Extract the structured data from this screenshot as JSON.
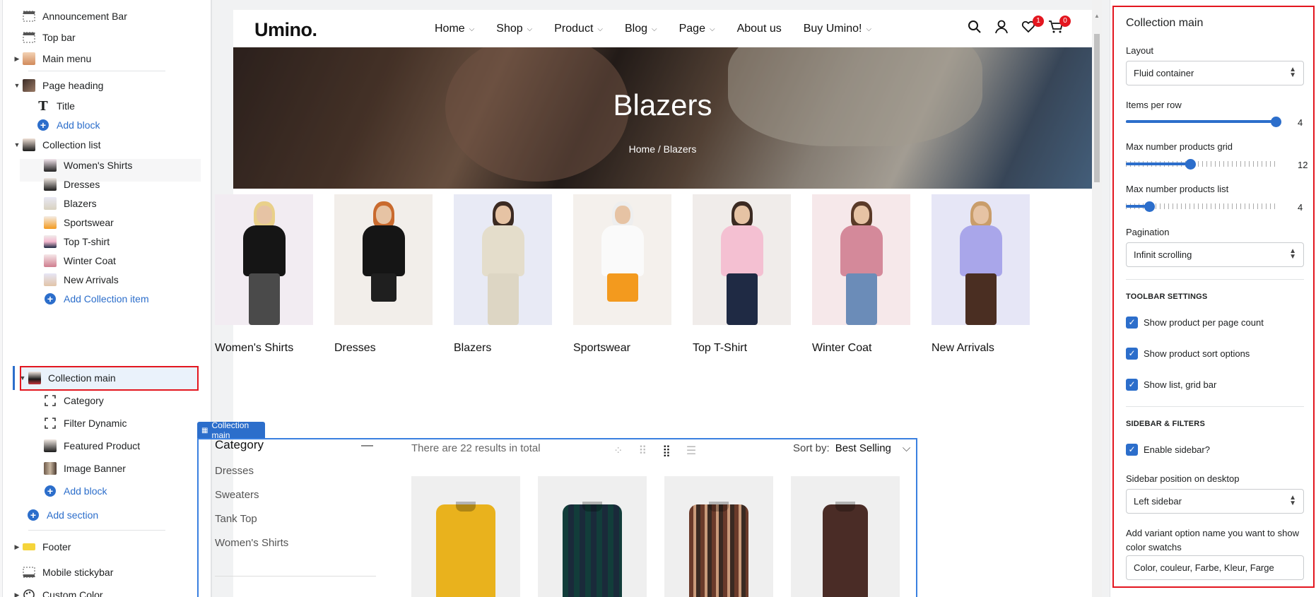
{
  "sidebar": {
    "items": [
      {
        "label": "Announcement Bar"
      },
      {
        "label": "Top bar"
      },
      {
        "label": "Main menu"
      },
      {
        "label": "Page heading"
      },
      {
        "label": "Title"
      },
      {
        "label": "Add block"
      },
      {
        "label": "Collection list"
      },
      {
        "label": "Women's Shirts"
      },
      {
        "label": "Dresses"
      },
      {
        "label": "Blazers"
      },
      {
        "label": "Sportswear"
      },
      {
        "label": "Top T-shirt"
      },
      {
        "label": "Winter Coat"
      },
      {
        "label": "New Arrivals"
      },
      {
        "label": "Add Collection item"
      },
      {
        "label": "Collection main"
      },
      {
        "label": "Category"
      },
      {
        "label": "Filter Dynamic"
      },
      {
        "label": "Featured Product"
      },
      {
        "label": "Image Banner"
      },
      {
        "label": "Add block"
      },
      {
        "label": "Add section"
      },
      {
        "label": "Footer"
      },
      {
        "label": "Mobile stickybar"
      },
      {
        "label": "Custom Color"
      }
    ]
  },
  "store": {
    "logo": "Umino.",
    "nav": [
      "Home",
      "Shop",
      "Product",
      "Blog",
      "Page",
      "About us",
      "Buy Umino!"
    ],
    "wishlist_count": "1",
    "cart_count": "0",
    "hero_title": "Blazers",
    "breadcrumb": "Home / Blazers",
    "collections": [
      "Women's Shirts",
      "Dresses",
      "Blazers",
      "Sportswear",
      "Top T-Shirt",
      "Winter Coat",
      "New Arrivals"
    ],
    "section_tag": "Collection main",
    "category_heading": "Category",
    "categories": [
      "Dresses",
      "Sweaters",
      "Tank Top",
      "Women's Shirts"
    ],
    "results_text": "There are 22 results in total",
    "sort_label": "Sort by:",
    "sort_value": "Best Selling"
  },
  "settings": {
    "title": "Collection main",
    "layout_label": "Layout",
    "layout_value": "Fluid container",
    "items_per_row_label": "Items per row",
    "items_per_row_value": "4",
    "items_per_row_level": 1.0,
    "max_grid_label": "Max number products grid",
    "max_grid_value": "12",
    "max_grid_level": 0.42,
    "max_list_label": "Max number products list",
    "max_list_value": "4",
    "max_list_level": 0.14,
    "pagination_label": "Pagination",
    "pagination_value": "Infinit scrolling",
    "toolbar_heading": "TOOLBAR SETTINGS",
    "show_per_page": "Show product per page count",
    "show_sort": "Show product sort options",
    "show_list_grid": "Show list, grid bar",
    "sidebar_heading": "SIDEBAR & FILTERS",
    "enable_sidebar": "Enable sidebar?",
    "sidebar_position_label": "Sidebar position on desktop",
    "sidebar_position_value": "Left sidebar",
    "swatch_label": "Add variant option name you want to show color swatchs",
    "swatch_value": "Color, couleur, Farbe, Kleur, Farge"
  },
  "colors": {
    "accent": "#2c6ecb",
    "highlight": "#e3161f"
  }
}
